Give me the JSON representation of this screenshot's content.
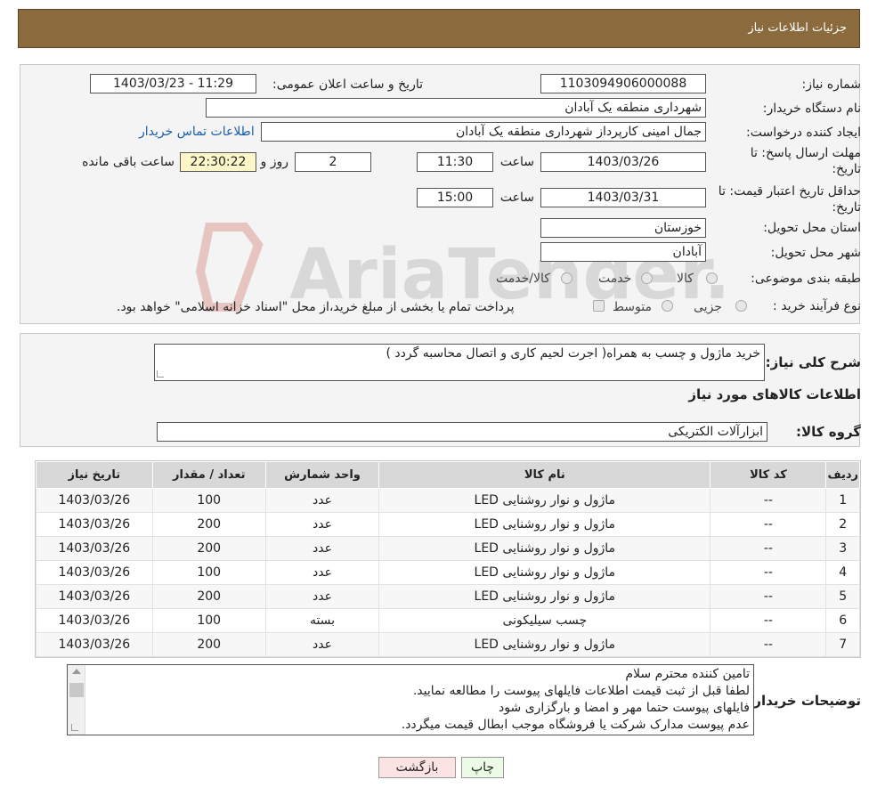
{
  "header": {
    "title": "جزئیات اطلاعات نیاز"
  },
  "form": {
    "need_number_label": "شماره نیاز:",
    "need_number": "1103094906000088",
    "announce_label": "تاریخ و ساعت اعلان عمومی:",
    "announce_value": "1403/03/23 - 11:29",
    "buyer_org_label": "نام دستگاه خریدار:",
    "buyer_org": "شهرداری منطقه یک آبادان",
    "requester_label": "ایجاد کننده درخواست:",
    "requester": "جمال امینی کارپرداز شهرداری منطقه یک آبادان",
    "contact_link": "اطلاعات تماس خریدار",
    "deadline_label_1": "مهلت ارسال پاسخ: تا",
    "deadline_label_2": "تاریخ:",
    "deadline_date": "1403/03/26",
    "time_label": "ساعت",
    "deadline_time": "11:30",
    "days_value": "2",
    "days_label": "روز و",
    "remaining_time": "22:30:22",
    "remaining_label": "ساعت باقی مانده",
    "validity_label_1": "حداقل تاریخ اعتبار قیمت: تا",
    "validity_label_2": "تاریخ:",
    "validity_date": "1403/03/31",
    "validity_time": "15:00",
    "province_label": "استان محل تحویل:",
    "province": "خوزستان",
    "city_label": "شهر محل تحویل:",
    "city": "آبادان",
    "category_label": "طبقه بندی موضوعی:",
    "category_options": [
      "کالا",
      "خدمت",
      "کالا/خدمت"
    ],
    "process_label": "نوع فرآیند خرید :",
    "process_options": [
      "جزیی",
      "متوسط"
    ],
    "process_note": "پرداخت تمام یا بخشی از مبلغ خرید،از محل \"اسناد خزانه اسلامی\" خواهد بود."
  },
  "description": {
    "label": "شرح کلی نیاز:",
    "text": "خرید ماژول و چسب به همراه( اجرت لحیم کاری و اتصال محاسبه گردد )"
  },
  "goods": {
    "section_title": "اطلاعات کالاهای مورد نیاز",
    "group_label": "گروه کالا:",
    "group_value": "ابزارآلات الکتریکی"
  },
  "table": {
    "headers": [
      "ردیف",
      "کد کالا",
      "نام کالا",
      "واحد شمارش",
      "تعداد / مقدار",
      "تاریخ نیاز"
    ],
    "rows": [
      [
        "1",
        "--",
        "ماژول و نوار روشنایی LED",
        "عدد",
        "100",
        "1403/03/26"
      ],
      [
        "2",
        "--",
        "ماژول و نوار روشنایی LED",
        "عدد",
        "200",
        "1403/03/26"
      ],
      [
        "3",
        "--",
        "ماژول و نوار روشنایی LED",
        "عدد",
        "200",
        "1403/03/26"
      ],
      [
        "4",
        "--",
        "ماژول و نوار روشنایی LED",
        "عدد",
        "100",
        "1403/03/26"
      ],
      [
        "5",
        "--",
        "ماژول و نوار روشنایی LED",
        "عدد",
        "200",
        "1403/03/26"
      ],
      [
        "6",
        "--",
        "چسب سیلیکونی",
        "بسته",
        "100",
        "1403/03/26"
      ],
      [
        "7",
        "--",
        "ماژول و نوار روشنایی LED",
        "عدد",
        "200",
        "1403/03/26"
      ]
    ]
  },
  "notes": {
    "label": "توضیحات خریدار:",
    "lines": [
      "تامین کننده محترم سلام",
      "لطفا قبل از ثبت قیمت اطلاعات فایلهای پیوست را مطالعه نمایید.",
      "فایلهای پیوست حتما مهر و امضا و بارگزاری شود",
      "عدم پیوست مدارک شرکت یا فروشگاه موجب ابطال قیمت میگردد."
    ]
  },
  "buttons": {
    "print": "چاپ",
    "back": "بازگشت"
  },
  "watermark": {
    "text": "AriaTender.neT"
  }
}
